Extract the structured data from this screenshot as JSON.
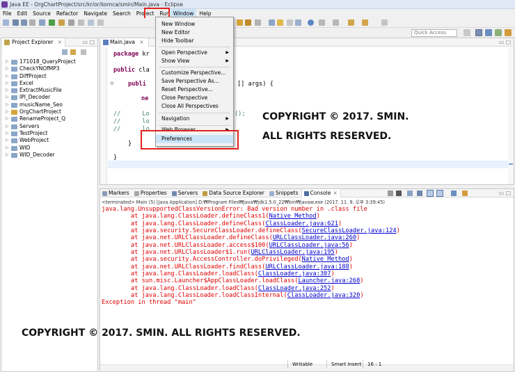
{
  "window": {
    "title": "Java EE - OrgChartProject/src/kr/or/komca/smin/Main.java - Eclipse"
  },
  "menubar": {
    "items": [
      "File",
      "Edit",
      "Source",
      "Refactor",
      "Navigate",
      "Search",
      "Project",
      "Run",
      "Window",
      "Help"
    ]
  },
  "window_menu": {
    "items": [
      {
        "label": "New Window",
        "submenu": false
      },
      {
        "label": "New Editor",
        "submenu": false
      },
      {
        "label": "Hide Toolbar",
        "submenu": false
      },
      {
        "label": "Open Perspective",
        "submenu": true
      },
      {
        "label": "Show View",
        "submenu": true
      },
      {
        "label": "Customize Perspective...",
        "submenu": false
      },
      {
        "label": "Save Perspective As...",
        "submenu": false
      },
      {
        "label": "Reset Perspective...",
        "submenu": false
      },
      {
        "label": "Close Perspective",
        "submenu": false
      },
      {
        "label": "Close All Perspectives",
        "submenu": false
      },
      {
        "label": "Navigation",
        "submenu": true
      },
      {
        "label": "Web Browser",
        "submenu": true
      },
      {
        "label": "Preferences",
        "submenu": false
      }
    ]
  },
  "toolbar": {
    "quick_access_placeholder": "Quick Access"
  },
  "project_explorer": {
    "tab_label": "Project Explorer",
    "projects": [
      "171018_QueryProject",
      "CheckYNOfMP3",
      "DiffProject",
      "Excel",
      "ExtractMusicFile",
      "IPI_Decoder",
      "musicName_Seo",
      "OrgChartProject",
      "RenameProject_Q",
      "Servers",
      "TestProject",
      "WebProject",
      "WID",
      "WID_Decoder"
    ]
  },
  "editor": {
    "tab_label": "Main.java",
    "code": {
      "package_kw": "package",
      "package_rest": " kr",
      "class_kw": "public",
      "class_rest": " cla",
      "method_kw": "publi",
      "method_rest": "[] args) {",
      "ne": "ne",
      "c1": "//      Lo",
      "c1b": "();",
      "c2": "//      lo",
      "c3": "//      lo",
      "brace1": "}",
      "brace2": "}"
    }
  },
  "watermark": {
    "line1": "COPYRIGHT © 2017. SMIN.",
    "line2": "ALL RIGHTS RESERVED.",
    "bottom": "COPYRIGHT © 2017. SMIN. ALL RIGHTS RESERVED."
  },
  "console": {
    "tabs": [
      "Markers",
      "Properties",
      "Servers",
      "Data Source Explorer",
      "Snippets",
      "Console"
    ],
    "active_tab": "Console",
    "terminated": "<terminated> Main (5) [Java Application] D:₩Program Files₩Java₩jdk1.5.0_22₩bin₩javaw.exe (2017. 11. 9. 오후 3:39:45)",
    "error_header": "java.lang.UnsupportedClassVersionError: Bad version number in .class file",
    "stack": [
      {
        "prefix": "        at java.lang.ClassLoader.defineClass1(",
        "link": "Native Method",
        "suffix": ")"
      },
      {
        "prefix": "        at java.lang.ClassLoader.defineClass(",
        "link": "ClassLoader.java:621",
        "suffix": ")"
      },
      {
        "prefix": "        at java.security.SecureClassLoader.defineClass(",
        "link": "SecureClassLoader.java:124",
        "suffix": ")"
      },
      {
        "prefix": "        at java.net.URLClassLoader.defineClass(",
        "link": "URLClassLoader.java:260",
        "suffix": ")"
      },
      {
        "prefix": "        at java.net.URLClassLoader.access$100(",
        "link": "URLClassLoader.java:56",
        "suffix": ")"
      },
      {
        "prefix": "        at java.net.URLClassLoader$1.run(",
        "link": "URLClassLoader.java:195",
        "suffix": ")"
      },
      {
        "prefix": "        at java.security.AccessController.doPrivileged(",
        "link": "Native Method",
        "suffix": ")"
      },
      {
        "prefix": "        at java.net.URLClassLoader.findClass(",
        "link": "URLClassLoader.java:188",
        "suffix": ")"
      },
      {
        "prefix": "        at java.lang.ClassLoader.loadClass(",
        "link": "ClassLoader.java:307",
        "suffix": ")"
      },
      {
        "prefix": "        at sun.misc.Launcher$AppClassLoader.loadClass(",
        "link": "Launcher.java:268",
        "suffix": ")"
      },
      {
        "prefix": "        at java.lang.ClassLoader.loadClass(",
        "link": "ClassLoader.java:252",
        "suffix": ")"
      },
      {
        "prefix": "        at java.lang.ClassLoader.loadClassInternal(",
        "link": "ClassLoader.java:320",
        "suffix": ")"
      }
    ],
    "footer": "Exception in thread \"main\""
  },
  "statusbar": {
    "mode": "Writable",
    "insert": "Smart Insert",
    "position": "16 : 1"
  },
  "colors": {
    "highlight_box": "#e3221c",
    "error_text": "#e00000",
    "link": "#0000cc"
  }
}
